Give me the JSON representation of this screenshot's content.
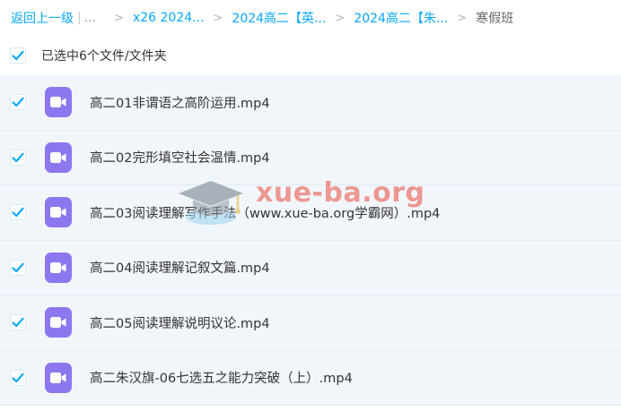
{
  "breadcrumb": {
    "back_label": "返回上一级",
    "separator": "|",
    "ellipsis": "...",
    "arrow": ">",
    "items": [
      "x26 2024...",
      "2024高二【英...",
      "2024高二【朱..."
    ],
    "current": "寒假班"
  },
  "selection": {
    "label": "已选中6个文件/文件夹",
    "checked": true
  },
  "files": [
    {
      "name": "高二01非谓语之高阶运用.mp4",
      "type": "video",
      "checked": true
    },
    {
      "name": "高二02完形填空社会温情.mp4",
      "type": "video",
      "checked": true
    },
    {
      "name": "高二03阅读理解写作手法（www.xue-ba.org学霸网）.mp4",
      "type": "video",
      "checked": true
    },
    {
      "name": "高二04阅读理解记叙文篇.mp4",
      "type": "video",
      "checked": true
    },
    {
      "name": "高二05阅读理解说明议论.mp4",
      "type": "video",
      "checked": true
    },
    {
      "name": "高二朱汉旗-06七选五之能力突破（上）.mp4",
      "type": "video",
      "checked": true
    }
  ],
  "watermark": {
    "text": "xue-ba.org"
  },
  "colors": {
    "accent": "#06a7ff",
    "row_background": "#f1f6fb",
    "video_icon": "#8c77ef",
    "watermark": "#e94b3c"
  },
  "icons": {
    "checkbox": "check-icon",
    "file": "video-file-icon",
    "watermark_logo": "graduation-cap-icon"
  }
}
